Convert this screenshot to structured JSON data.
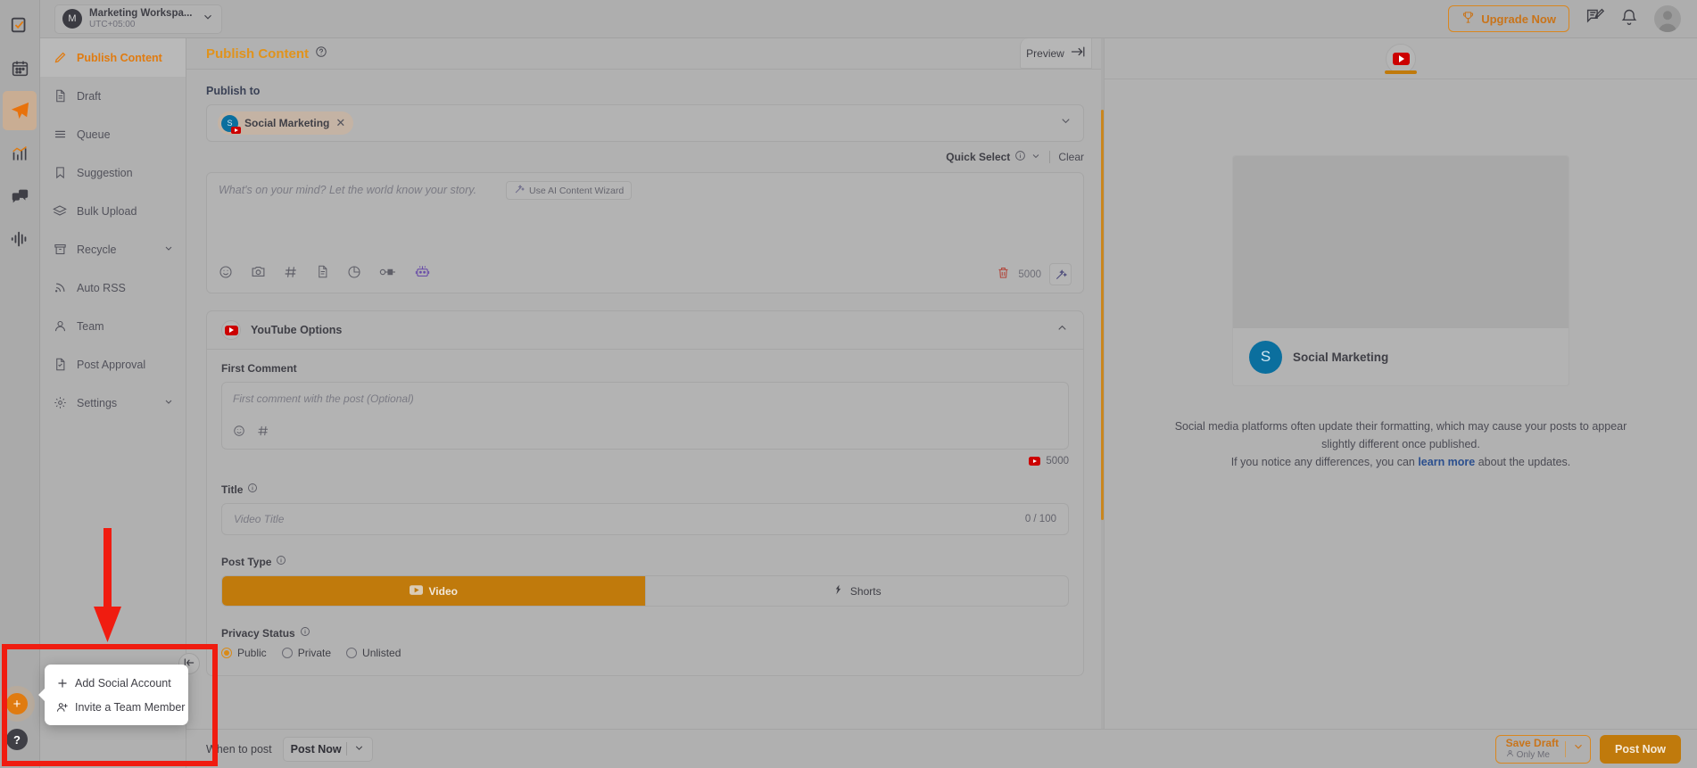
{
  "rail": {
    "items": [
      {
        "name": "tasks-icon",
        "label": "Tasks"
      },
      {
        "name": "calendar-icon",
        "label": "Calendar"
      },
      {
        "name": "publish-icon",
        "label": "Publish"
      },
      {
        "name": "analytics-icon",
        "label": "Analytics"
      },
      {
        "name": "inbox-icon",
        "label": "Inbox"
      },
      {
        "name": "listening-icon",
        "label": "Listening"
      }
    ]
  },
  "workspace": {
    "avatar_initial": "M",
    "name": "Marketing Workspa...",
    "timezone": "UTC+05:00"
  },
  "topbar": {
    "upgrade_label": "Upgrade Now",
    "trophy_icon": "trophy-icon",
    "feedback_icon": "feedback-icon",
    "notification_icon": "bell-icon",
    "avatar_icon": "user-avatar"
  },
  "sidebar": {
    "items": [
      {
        "label": "Publish Content",
        "icon": "pencil-icon",
        "active": true,
        "chevron": false
      },
      {
        "label": "Draft",
        "icon": "document-icon",
        "active": false,
        "chevron": false
      },
      {
        "label": "Queue",
        "icon": "list-icon",
        "active": false,
        "chevron": false
      },
      {
        "label": "Suggestion",
        "icon": "bookmark-icon",
        "active": false,
        "chevron": false
      },
      {
        "label": "Bulk Upload",
        "icon": "layers-icon",
        "active": false,
        "chevron": false
      },
      {
        "label": "Recycle",
        "icon": "archive-icon",
        "active": false,
        "chevron": true
      },
      {
        "label": "Auto RSS",
        "icon": "rss-icon",
        "active": false,
        "chevron": false
      },
      {
        "label": "Team",
        "icon": "person-icon",
        "active": false,
        "chevron": false
      },
      {
        "label": "Post Approval",
        "icon": "document-check-icon",
        "active": false,
        "chevron": false
      },
      {
        "label": "Settings",
        "icon": "gear-icon",
        "active": false,
        "chevron": true
      }
    ],
    "add_button_label": "+",
    "help_button_label": "?",
    "collapse_label": "|←"
  },
  "popup": {
    "items": [
      {
        "label": "Add Social Account",
        "icon": "plus-icon"
      },
      {
        "label": "Invite a Team Member",
        "icon": "person-add-icon"
      }
    ]
  },
  "content": {
    "title": "Publish Content",
    "help_icon": "question-circle-icon",
    "publish_to_label": "Publish to",
    "chip": {
      "initial": "S",
      "name": "Social Marketing",
      "platform_icon": "youtube-icon",
      "remove_icon": "close-icon"
    },
    "quick_select_label": "Quick Select",
    "quick_select_info_icon": "info-icon",
    "clear_label": "Clear",
    "editor": {
      "placeholder": "What's on your mind? Let the world know your story.",
      "ai_wizard_label": "Use AI Content Wizard",
      "ai_wizard_icon": "magic-wand-icon",
      "toolbar_icons": [
        "emoji-icon",
        "camera-icon",
        "hashtag-icon",
        "document-icon",
        "poll-icon",
        "link-icon",
        "robot-icon"
      ],
      "delete_icon": "trash-icon",
      "char_limit": "5000",
      "magic_icon": "magic-wand-icon"
    }
  },
  "youtube_options": {
    "title": "YouTube Options",
    "logo_icon": "youtube-icon",
    "collapse_icon": "chevron-up-icon",
    "first_comment_label": "First Comment",
    "first_comment_placeholder": "First comment with the post (Optional)",
    "first_comment_toolbar": [
      "emoji-icon",
      "hashtag-icon"
    ],
    "first_comment_limit": "5000",
    "title_label": "Title",
    "title_info_icon": "info-icon",
    "title_placeholder": "Video Title",
    "title_counter": "0 / 100",
    "post_type_label": "Post Type",
    "post_type_info_icon": "info-icon",
    "post_types": [
      {
        "label": "Video",
        "icon": "video-icon",
        "active": true
      },
      {
        "label": "Shorts",
        "icon": "shorts-icon",
        "active": false
      }
    ],
    "privacy_label": "Privacy Status",
    "privacy_info_icon": "info-icon",
    "privacy_options": [
      {
        "label": "Public",
        "selected": true
      },
      {
        "label": "Private",
        "selected": false
      },
      {
        "label": "Unlisted",
        "selected": false
      }
    ]
  },
  "bottom_bar": {
    "when_to_post_label": "When to post",
    "when_to_post_value": "Post Now",
    "chevron_icon": "chevron-down-icon",
    "save_draft_label": "Save Draft",
    "save_draft_sub": "Only Me",
    "save_draft_icon": "person-icon",
    "save_draft_chevron": "chevron-down-icon",
    "post_now_label": "Post Now"
  },
  "preview": {
    "toggle_label": "Preview",
    "toggle_icon": "collapse-right-icon",
    "tab_icon": "youtube-icon",
    "account_initial": "S",
    "account_name": "Social Marketing",
    "note_line1": "Social media platforms often update their formatting, which may cause your posts",
    "note_line2": "to appear slightly different once published.",
    "note_line3_before": "If you notice any differences, you can ",
    "note_link": "learn more",
    "note_line3_after": " about the updates."
  },
  "annotation": {
    "accent_color": "#f01c10",
    "arrow": "down-arrow",
    "rect": "highlight-rectangle"
  },
  "colors": {
    "brand_orange": "#e07b10",
    "active_orange": "#c07a0c",
    "youtube_red": "#cc0000",
    "link_blue": "#2b4f8e"
  }
}
